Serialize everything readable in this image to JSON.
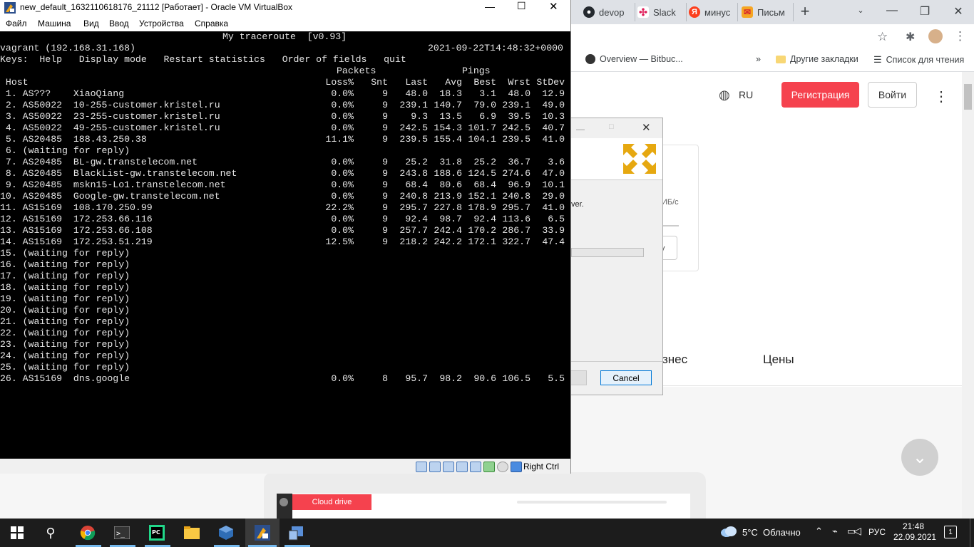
{
  "browser": {
    "tabs": [
      {
        "label": "devop",
        "icon": "github-icon"
      },
      {
        "label": "Slack",
        "icon": "slack-icon"
      },
      {
        "label": "минус",
        "icon": "yandex-icon"
      },
      {
        "label": "Письм",
        "icon": "mail-icon"
      }
    ],
    "bookmarks": {
      "overview": "Overview — Bitbuc...",
      "more": "»",
      "other": "Другие закладки",
      "reading": "Список для чтения"
    },
    "page": {
      "lang": "RU",
      "register": "Регистрация",
      "login": "Войти",
      "nav_business": "знес",
      "nav_prices": "Цены",
      "cloud_drive": "Cloud drive",
      "frag_speed": "ИБ/с",
      "frag_btn": "у"
    }
  },
  "dialog": {
    "frag_text": "ver.",
    "cancel": "Cancel"
  },
  "vbox": {
    "title": "new_default_1632110618176_21112 [Работает] - Oracle VM VirtualBox",
    "menu": [
      "Файл",
      "Машина",
      "Вид",
      "Ввод",
      "Устройства",
      "Справка"
    ],
    "status_host_key": "Right Ctrl"
  },
  "terminal": {
    "app_title": "My traceroute  [v0.93]",
    "host_line": "vagrant (192.168.31.168)",
    "timestamp": "2021-09-22T14:48:32+0000",
    "keys_line": "Keys:  Help   Display mode   Restart statistics   Order of fields   quit",
    "group_packets": "Packets",
    "group_pings": "Pings",
    "headers": {
      "host": " Host",
      "loss": "Loss%",
      "snt": "Snt",
      "last": "Last",
      "avg": "Avg",
      "best": "Best",
      "wrst": "Wrst",
      "stdev": "StDev"
    },
    "rows": [
      {
        "host": " 1. AS???    XiaoQiang",
        "loss": "0.0%",
        "snt": "9",
        "last": "48.0",
        "avg": "18.3",
        "best": "3.1",
        "wrst": "48.0",
        "stdev": "12.9"
      },
      {
        "host": " 2. AS50022  10-255-customer.kristel.ru",
        "loss": "0.0%",
        "snt": "9",
        "last": "239.1",
        "avg": "140.7",
        "best": "79.0",
        "wrst": "239.1",
        "stdev": "49.0"
      },
      {
        "host": " 3. AS50022  23-255-customer.kristel.ru",
        "loss": "0.0%",
        "snt": "9",
        "last": "9.3",
        "avg": "13.5",
        "best": "6.9",
        "wrst": "39.5",
        "stdev": "10.3"
      },
      {
        "host": " 4. AS50022  49-255-customer.kristel.ru",
        "loss": "0.0%",
        "snt": "9",
        "last": "242.5",
        "avg": "154.3",
        "best": "101.7",
        "wrst": "242.5",
        "stdev": "40.7"
      },
      {
        "host": " 5. AS20485  188.43.250.38",
        "loss": "11.1%",
        "snt": "9",
        "last": "239.5",
        "avg": "155.4",
        "best": "104.1",
        "wrst": "239.5",
        "stdev": "41.0"
      },
      {
        "host": " 6. (waiting for reply)"
      },
      {
        "host": " 7. AS20485  BL-gw.transtelecom.net",
        "loss": "0.0%",
        "snt": "9",
        "last": "25.2",
        "avg": "31.8",
        "best": "25.2",
        "wrst": "36.7",
        "stdev": "3.6"
      },
      {
        "host": " 8. AS20485  BlackList-gw.transtelecom.net",
        "loss": "0.0%",
        "snt": "9",
        "last": "243.8",
        "avg": "188.6",
        "best": "124.5",
        "wrst": "274.6",
        "stdev": "47.0"
      },
      {
        "host": " 9. AS20485  mskn15-Lo1.transtelecom.net",
        "loss": "0.0%",
        "snt": "9",
        "last": "68.4",
        "avg": "80.6",
        "best": "68.4",
        "wrst": "96.9",
        "stdev": "10.1"
      },
      {
        "host": "10. AS20485  Google-gw.transtelecom.net",
        "loss": "0.0%",
        "snt": "9",
        "last": "240.8",
        "avg": "213.9",
        "best": "152.1",
        "wrst": "240.8",
        "stdev": "29.0"
      },
      {
        "host": "11. AS15169  108.170.250.99",
        "loss": "22.2%",
        "snt": "9",
        "last": "295.7",
        "avg": "227.8",
        "best": "178.9",
        "wrst": "295.7",
        "stdev": "41.0"
      },
      {
        "host": "12. AS15169  172.253.66.116",
        "loss": "0.0%",
        "snt": "9",
        "last": "92.4",
        "avg": "98.7",
        "best": "92.4",
        "wrst": "113.6",
        "stdev": "6.5"
      },
      {
        "host": "13. AS15169  172.253.66.108",
        "loss": "0.0%",
        "snt": "9",
        "last": "257.7",
        "avg": "242.4",
        "best": "170.2",
        "wrst": "286.7",
        "stdev": "33.9"
      },
      {
        "host": "14. AS15169  172.253.51.219",
        "loss": "12.5%",
        "snt": "9",
        "last": "218.2",
        "avg": "242.2",
        "best": "172.1",
        "wrst": "322.7",
        "stdev": "47.4"
      },
      {
        "host": "15. (waiting for reply)"
      },
      {
        "host": "16. (waiting for reply)"
      },
      {
        "host": "17. (waiting for reply)"
      },
      {
        "host": "18. (waiting for reply)"
      },
      {
        "host": "19. (waiting for reply)"
      },
      {
        "host": "20. (waiting for reply)"
      },
      {
        "host": "21. (waiting for reply)"
      },
      {
        "host": "22. (waiting for reply)"
      },
      {
        "host": "23. (waiting for reply)"
      },
      {
        "host": "24. (waiting for reply)"
      },
      {
        "host": "25. (waiting for reply)"
      },
      {
        "host": "26. AS15169  dns.google",
        "loss": "0.0%",
        "snt": "8",
        "last": "95.7",
        "avg": "98.2",
        "best": "90.6",
        "wrst": "106.5",
        "stdev": "5.5"
      }
    ]
  },
  "taskbar": {
    "weather": "5°C  Облачно",
    "lang": "РУС",
    "time": "21:48",
    "date": "22.09.2021",
    "notifications": "1"
  }
}
